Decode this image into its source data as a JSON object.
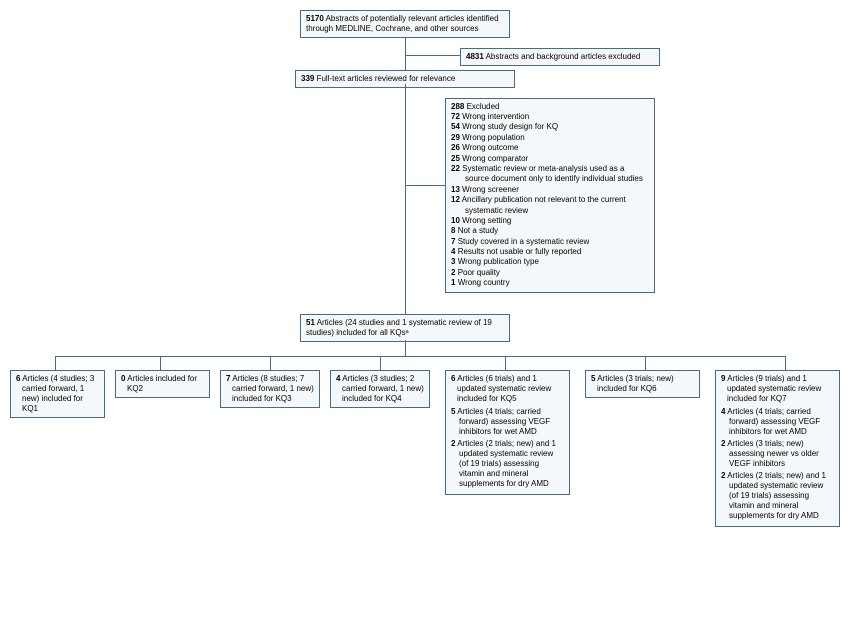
{
  "top": {
    "abstracts_n": "5170",
    "abstracts_text": "Abstracts of potentially relevant articles identified through MEDLINE, Cochrane, and other sources",
    "excluded_bg_n": "4831",
    "excluded_bg_text": "Abstracts and background articles excluded",
    "fulltext_n": "339",
    "fulltext_text": "Full-text articles reviewed for relevance"
  },
  "excluded": {
    "header_n": "288",
    "header_text": "Excluded",
    "items": [
      {
        "n": "72",
        "t": "Wrong intervention"
      },
      {
        "n": "54",
        "t": "Wrong study design for KQ"
      },
      {
        "n": "29",
        "t": "Wrong population"
      },
      {
        "n": "26",
        "t": "Wrong outcome"
      },
      {
        "n": "25",
        "t": "Wrong comparator"
      },
      {
        "n": "22",
        "t": "Systematic review or meta-analysis used as a source document only to identify individual studies"
      },
      {
        "n": "13",
        "t": "Wrong screener"
      },
      {
        "n": "12",
        "t": "Ancillary publication not relevant to the current systematic review"
      },
      {
        "n": "10",
        "t": "Wrong setting"
      },
      {
        "n": "8",
        "t": "Not a study"
      },
      {
        "n": "7",
        "t": "Study covered in a systematic review"
      },
      {
        "n": "4",
        "t": "Results not usable or fully reported"
      },
      {
        "n": "3",
        "t": "Wrong publication type"
      },
      {
        "n": "2",
        "t": "Poor quality"
      },
      {
        "n": "1",
        "t": "Wrong country"
      }
    ]
  },
  "included": {
    "n": "51",
    "text": "Articles (24 studies and 1 systematic review of 19 studies) included for all KQsᵃ"
  },
  "kq": {
    "kq1_n": "6",
    "kq1_t": "Articles (4 studies; 3 carried forward, 1 new) included for KQ1",
    "kq2_n": "0",
    "kq2_t": "Articles included for KQ2",
    "kq3_n": "7",
    "kq3_t": "Articles (8 studies; 7 carried forward, 1 new) included for KQ3",
    "kq4_n": "4",
    "kq4_t": "Articles (3 studies; 2 carried forward, 1 new) included for KQ4",
    "kq5_n": "6",
    "kq5_t": "Articles (6 trials) and 1 updated systematic review included for KQ5",
    "kq5_a_n": "5",
    "kq5_a_t": "Articles (4 trials; carried forward) assessing VEGF inhibitors for wet AMD",
    "kq5_b_n": "2",
    "kq5_b_t": "Articles (2 trials; new) and 1 updated systematic review (of 19 trials) assessing vitamin and mineral supplements for dry AMD",
    "kq6_n": "5",
    "kq6_t": "Articles (3 trials; new) included for KQ6",
    "kq7_n": "9",
    "kq7_t": "Articles (9 trials) and 1 updated systematic review included for KQ7",
    "kq7_a_n": "4",
    "kq7_a_t": "Articles (4 trials; carried forward) assessing VEGF inhibitors for wet AMD",
    "kq7_b_n": "2",
    "kq7_b_t": "Articles (3 trials; new) assessing newer vs older VEGF inhibitors",
    "kq7_c_n": "2",
    "kq7_c_t": "Articles (2 trials; new) and 1 updated systematic review (of 19 trials) assessing vitamin and mineral supplements for dry AMD"
  }
}
